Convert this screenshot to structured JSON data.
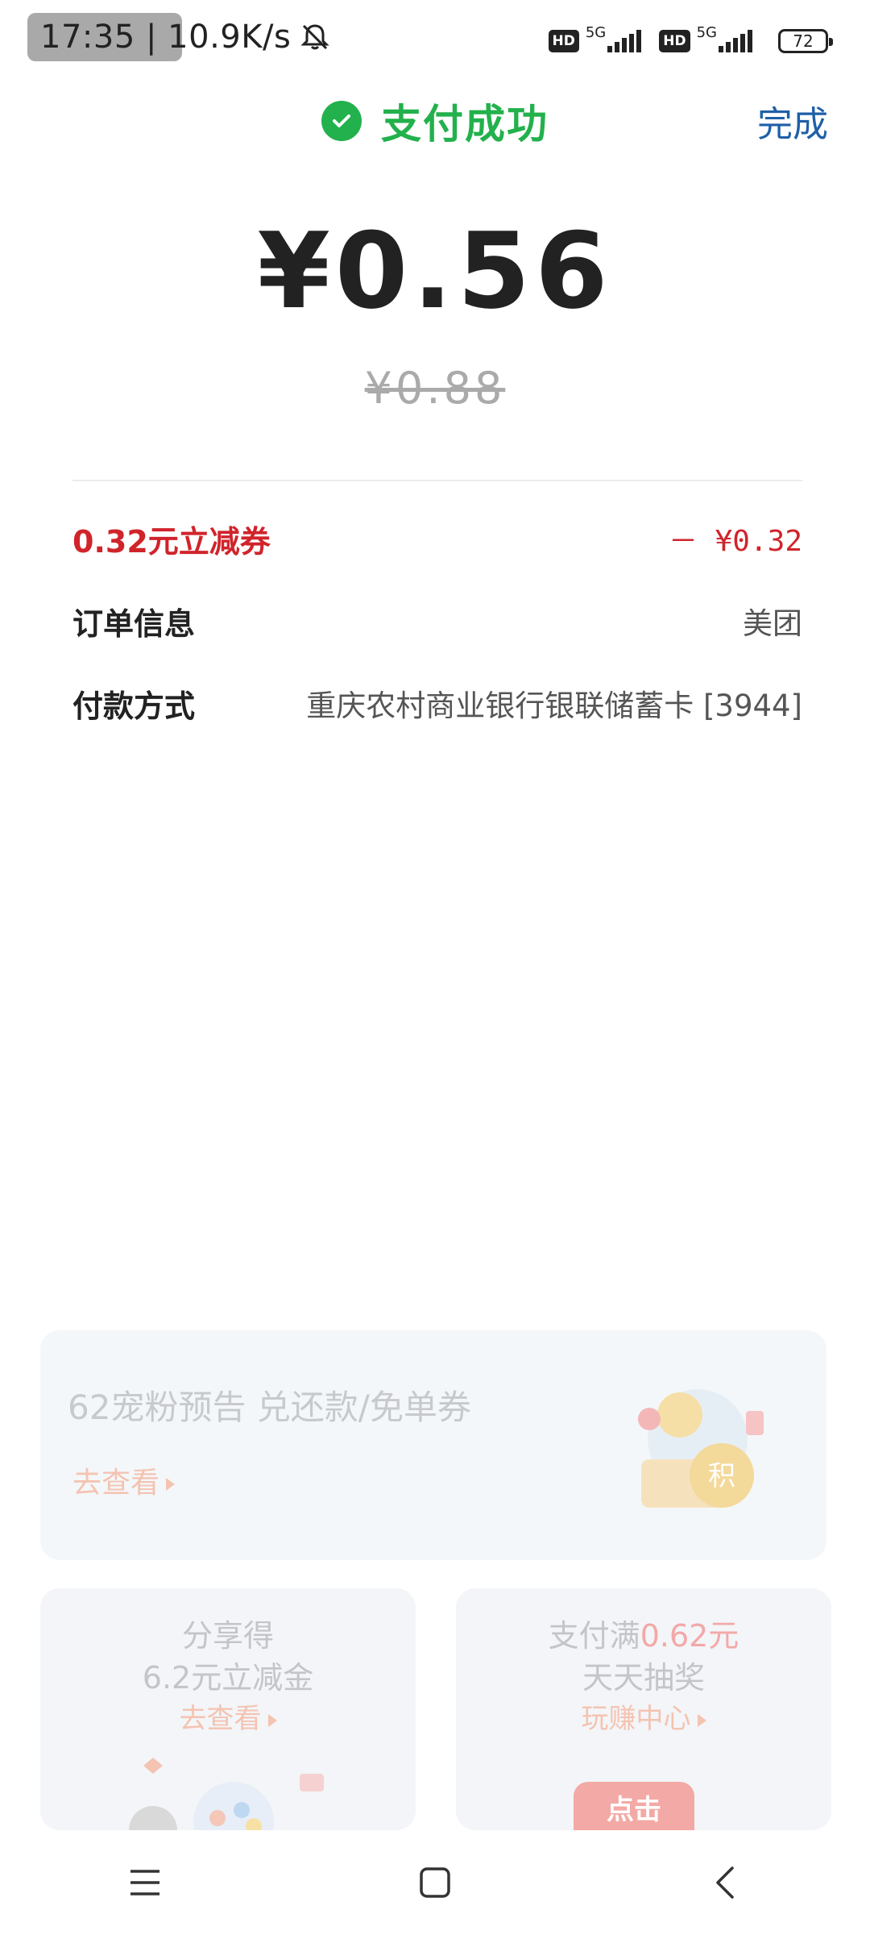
{
  "status_bar": {
    "time_speed": "17:35 | 10.9K/s",
    "net1": "HD",
    "net1_type": "5G",
    "net2": "HD",
    "net2_type": "5G",
    "battery": "72"
  },
  "header": {
    "title": "支付成功",
    "done_label": "完成"
  },
  "payment": {
    "amount": "¥0.56",
    "original_amount": "¥0.88"
  },
  "details": [
    {
      "label": "0.32元立减券",
      "value": "－ ¥0.32"
    },
    {
      "label": "订单信息",
      "value": "美团"
    },
    {
      "label": "付款方式",
      "value": "重庆农村商业银行银联储蓄卡 [3944]"
    }
  ],
  "promo_banner": {
    "title": "62宠粉预告 兑还款/免单券",
    "link": "去查看"
  },
  "promo_cards": [
    {
      "line1": "分享得",
      "line2": "6.2元立减金",
      "link": "去查看"
    },
    {
      "line1_prefix": "支付满",
      "line1_highlight": "0.62元",
      "line2": "天天抽奖",
      "link": "玩赚中心",
      "button": "点击"
    }
  ],
  "colors": {
    "success_green": "#22b14c",
    "link_blue": "#1f5fa8",
    "discount_red": "#d0242b"
  }
}
